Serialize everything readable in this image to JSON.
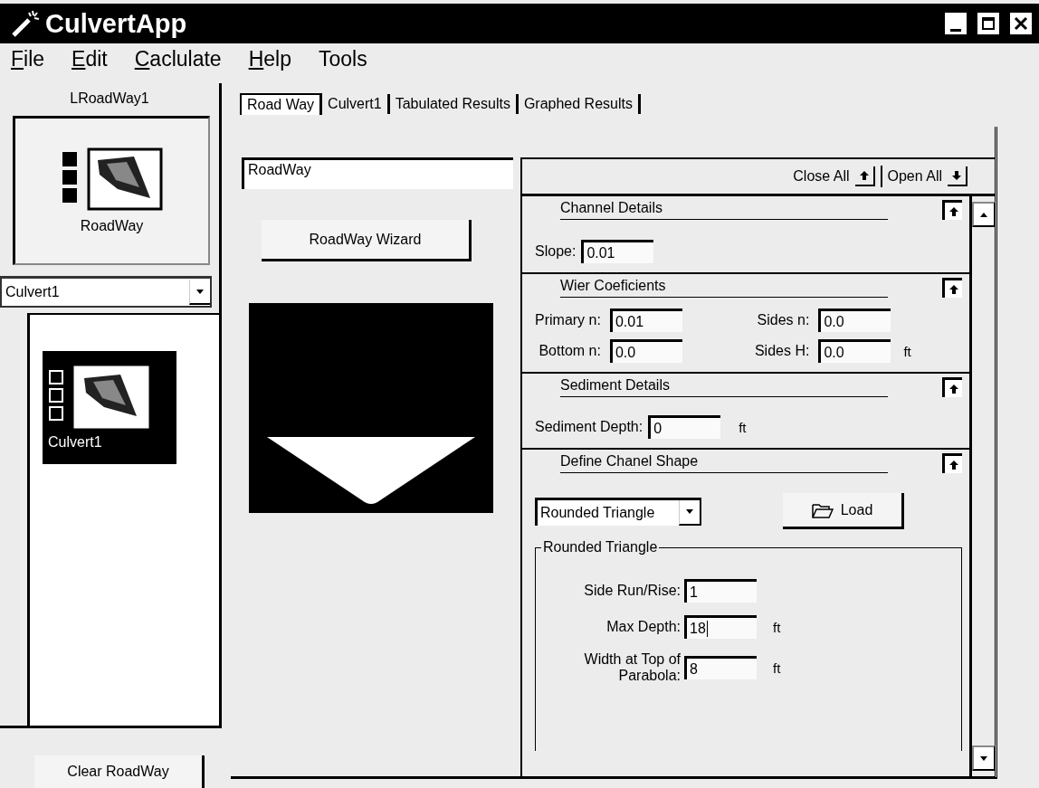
{
  "window": {
    "title": "CulvertApp"
  },
  "menu": [
    {
      "label": "File",
      "underline_first": true
    },
    {
      "label": "Edit",
      "underline_first": true
    },
    {
      "label": "Caclulate",
      "underline_first": true
    },
    {
      "label": "Help",
      "underline_first": true
    },
    {
      "label": "Tools",
      "underline_first": false
    }
  ],
  "left_panel": {
    "title": "LRoadWay1",
    "roadway_item": {
      "label": "RoadWay"
    },
    "selector": {
      "value": "Culvert1"
    },
    "items": [
      {
        "label": "Culvert1",
        "selected": true
      }
    ],
    "clear_button": "Clear RoadWay"
  },
  "tabs": [
    {
      "label": "Road Way",
      "selected": true
    },
    {
      "label": "Culvert1",
      "selected": false
    },
    {
      "label": "Tabulated Results",
      "selected": false
    },
    {
      "label": "Graphed Results",
      "selected": false
    }
  ],
  "center": {
    "name_field": {
      "value": "RoadWay"
    },
    "wizard_button": "RoadWay Wizard"
  },
  "details": {
    "close_all": "Close All",
    "open_all": "Open All",
    "sections": [
      {
        "kind": "single",
        "title": "Channel Details",
        "expanded": true,
        "fields": [
          {
            "label": "Slope:",
            "value": "0.01"
          }
        ]
      },
      {
        "kind": "grid",
        "title": "Wier Coeficients",
        "expanded": true,
        "fields": [
          {
            "label": "Primary n:",
            "value": "0.01"
          },
          {
            "label": "Sides n:",
            "value": "0.0"
          },
          {
            "label": "Bottom n:",
            "value": "0.0"
          },
          {
            "label": "Sides H:",
            "value": "0.0",
            "unit": "ft"
          }
        ]
      },
      {
        "kind": "single",
        "title": "Sediment Details",
        "expanded": true,
        "fields": [
          {
            "label": "Sediment Depth:",
            "value": "0",
            "unit": "ft"
          }
        ]
      },
      {
        "kind": "shape",
        "title": "Define Chanel Shape",
        "expanded": true,
        "shape_select": {
          "value": "Rounded Triangle"
        },
        "load_button": "Load",
        "group": {
          "title": "Rounded Triangle",
          "fields": [
            {
              "label": "Side Run/Rise:",
              "value": "1",
              "focused": false
            },
            {
              "label": "Max Depth:",
              "value": "18",
              "unit": "ft",
              "focused": true
            },
            {
              "label": "Width at Top of Parabola:",
              "value": "8",
              "unit": "ft",
              "focused": false
            }
          ]
        }
      }
    ]
  }
}
